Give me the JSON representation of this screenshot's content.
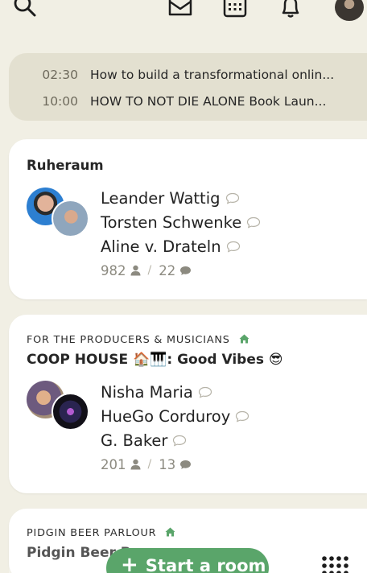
{
  "top_bar": {
    "icons": [
      "search-icon",
      "invite-envelope-icon",
      "calendar-icon",
      "notification-bell-icon",
      "profile-avatar"
    ]
  },
  "upcoming": [
    {
      "time": "02:30",
      "title": "How to build a transformational onlin..."
    },
    {
      "time": "10:00",
      "title": "HOW TO NOT DIE ALONE Book Laun..."
    }
  ],
  "rooms": [
    {
      "club": "",
      "title": "Ruheraum",
      "speakers": [
        "Leander Wattig",
        "Torsten Schwenke",
        "Aline v. Drateln"
      ],
      "listeners": "982",
      "speakers_count": "22"
    },
    {
      "club": "FOR THE PRODUCERS & MUSICIANS",
      "title": "COOP HOUSE 🏠🎹: Good Vibes 😎",
      "speakers": [
        "Nisha Maria",
        "HueGo Corduroy",
        "G. Baker"
      ],
      "listeners": "201",
      "speakers_count": "13"
    },
    {
      "club": "PIDGIN BEER PARLOUR",
      "title": "Pidgin Beer P",
      "speakers": [],
      "listeners": "",
      "speakers_count": ""
    }
  ],
  "start_room": {
    "label": "Start a room"
  },
  "colors": {
    "accent_green": "#5aa56a",
    "background": "#f1efe4",
    "upcoming_bg": "#e3e0d0"
  }
}
